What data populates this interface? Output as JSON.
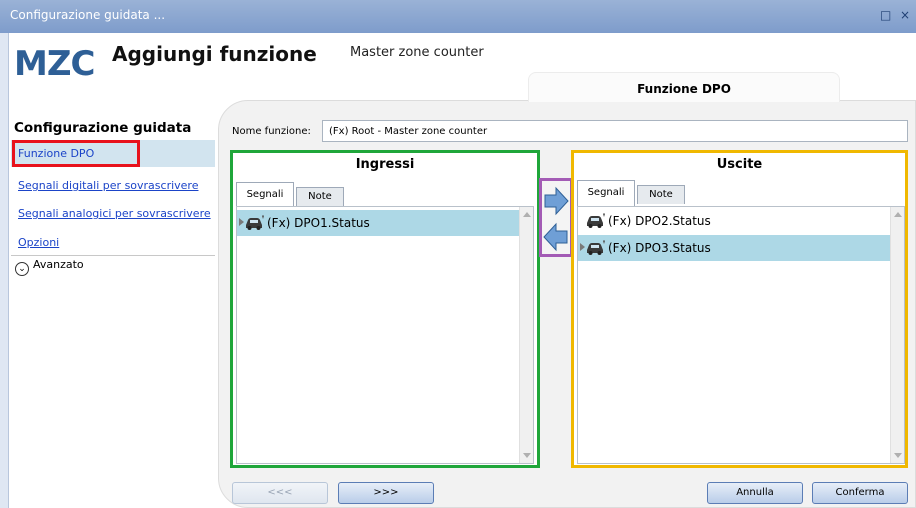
{
  "window": {
    "title": "Configurazione guidata ...",
    "controls": [
      "□",
      "×"
    ]
  },
  "header": {
    "logo": "MZC",
    "title": "Aggiungi funzione",
    "subtitle": "Master zone counter",
    "tab_label": "Funzione DPO"
  },
  "sidebar": {
    "title": "Configurazione guidata",
    "items": [
      {
        "label": "Funzione DPO"
      },
      {
        "label": "Segnali digitali per sovrascrivere"
      },
      {
        "label": "Segnali analogici per sovrascrivere"
      },
      {
        "label": "Opzioni"
      }
    ],
    "advanced_label": "Avanzato"
  },
  "form": {
    "name_label": "Nome funzione:",
    "name_value": "(Fx) Root - Master zone counter"
  },
  "inputs": {
    "title": "Ingressi",
    "tabs": [
      "Segnali",
      "Note"
    ],
    "items": [
      {
        "label": "(Fx) DPO1.Status",
        "icon": "car-icon",
        "selected": true
      }
    ]
  },
  "outputs": {
    "title": "Uscite",
    "tabs": [
      "Segnali",
      "Note"
    ],
    "items": [
      {
        "label": "(Fx) DPO2.Status",
        "icon": "car-icon",
        "selected": false
      },
      {
        "label": "(Fx) DPO3.Status",
        "icon": "car-icon",
        "selected": true
      }
    ]
  },
  "footer": {
    "prev_label": "<<<",
    "next_label": ">>>",
    "cancel_label": "Annulla",
    "confirm_label": "Conferma"
  },
  "colors": {
    "inputs_border": "#1fa63a",
    "outputs_border": "#f0b800",
    "arrows_border": "#a35bb5",
    "highlight_border": "#e8121c",
    "selection": "#add8e6"
  }
}
